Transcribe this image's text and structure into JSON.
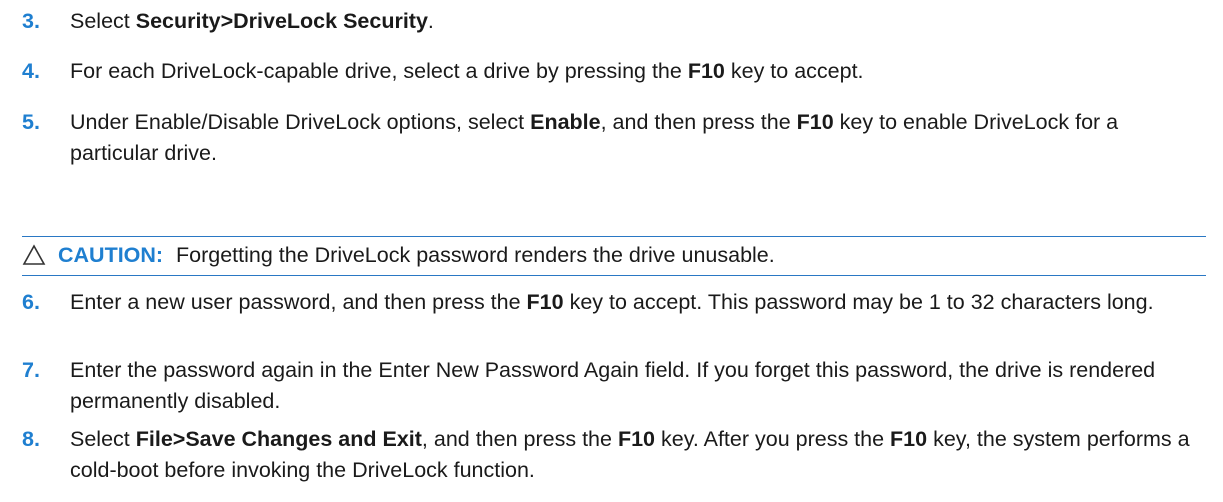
{
  "steps": [
    {
      "number": "3.",
      "parts": [
        {
          "text": "Select "
        },
        {
          "text": "Security>DriveLock Security",
          "bold": true
        },
        {
          "text": "."
        }
      ]
    },
    {
      "number": "4.",
      "parts": [
        {
          "text": "For each DriveLock-capable drive, select a drive by pressing the "
        },
        {
          "text": "F10",
          "bold": true
        },
        {
          "text": " key to accept."
        }
      ]
    },
    {
      "number": "5.",
      "parts": [
        {
          "text": "Under Enable/Disable DriveLock options, select "
        },
        {
          "text": "Enable",
          "bold": true
        },
        {
          "text": ", and then press the "
        },
        {
          "text": "F10",
          "bold": true
        },
        {
          "text": " key to enable DriveLock for a particular drive."
        }
      ]
    },
    {
      "number": "6.",
      "parts": [
        {
          "text": "Enter a new user password, and then press the "
        },
        {
          "text": "F10",
          "bold": true
        },
        {
          "text": " key to accept. This password may be 1 to 32 characters long."
        }
      ]
    },
    {
      "number": "7.",
      "parts": [
        {
          "text": "Enter the password again in the Enter New Password Again field. If you forget this password, the drive is rendered permanently disabled."
        }
      ]
    },
    {
      "number": "8.",
      "parts": [
        {
          "text": "Select "
        },
        {
          "text": "File>Save Changes and Exit",
          "bold": true
        },
        {
          "text": ", and then press the "
        },
        {
          "text": "F10",
          "bold": true
        },
        {
          "text": " key. After you press the "
        },
        {
          "text": "F10",
          "bold": true
        },
        {
          "text": " key, the system performs a cold-boot before invoking the DriveLock function."
        }
      ]
    }
  ],
  "caution": {
    "icon": "caution-triangle-icon",
    "label": "CAUTION:",
    "text": "Forgetting the DriveLock password renders the drive unusable."
  },
  "colors": {
    "accent": "#1f7fd0",
    "rule": "#2a78c4",
    "text": "#1a1a1a"
  }
}
